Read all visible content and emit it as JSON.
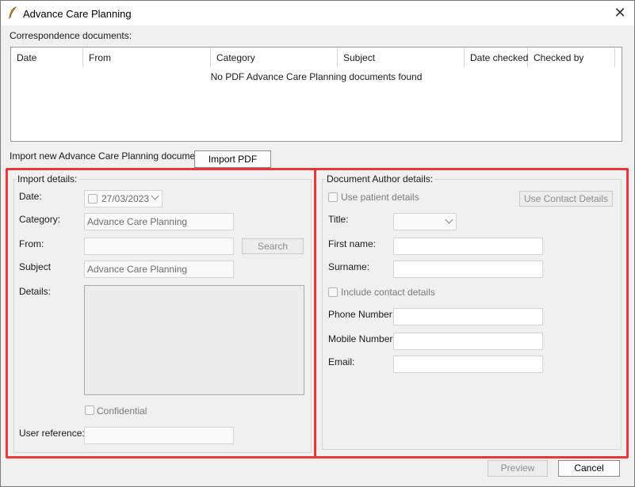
{
  "window": {
    "title": "Advance Care Planning",
    "close_icon": "close-icon",
    "app_icon": "feather-quill-icon"
  },
  "correspondence": {
    "label": "Correspondence documents:",
    "columns": [
      "Date",
      "From",
      "Category",
      "Subject",
      "Date checked",
      "Checked by"
    ],
    "empty_message": "No PDF Advance Care Planning documents found"
  },
  "import_new": {
    "label": "Import new Advance Care Planning document",
    "button_label": "Import PDF"
  },
  "import_details": {
    "title": "Import details:",
    "date_label": "Date:",
    "date_value": "27/03/2023",
    "category_label": "Category:",
    "category_value": "Advance Care Planning",
    "from_label": "From:",
    "from_value": "",
    "search_label": "Search",
    "subject_label": "Subject",
    "subject_value": "Advance Care Planning",
    "details_label": "Details:",
    "confidential_label": "Confidential",
    "user_reference_label": "User reference:",
    "user_reference_value": ""
  },
  "author_details": {
    "title": "Document Author details:",
    "use_patient_label": "Use patient details",
    "use_contact_label": "Use Contact Details",
    "title_label": "Title:",
    "first_name_label": "First name:",
    "surname_label": "Surname:",
    "include_contact_label": "Include contact details",
    "phone_label": "Phone Number:",
    "mobile_label": "Mobile Number:",
    "email_label": "Email:"
  },
  "footer": {
    "preview_label": "Preview",
    "cancel_label": "Cancel"
  },
  "colors": {
    "highlight": "#e5383e",
    "window_bg": "#f0f0f0"
  }
}
